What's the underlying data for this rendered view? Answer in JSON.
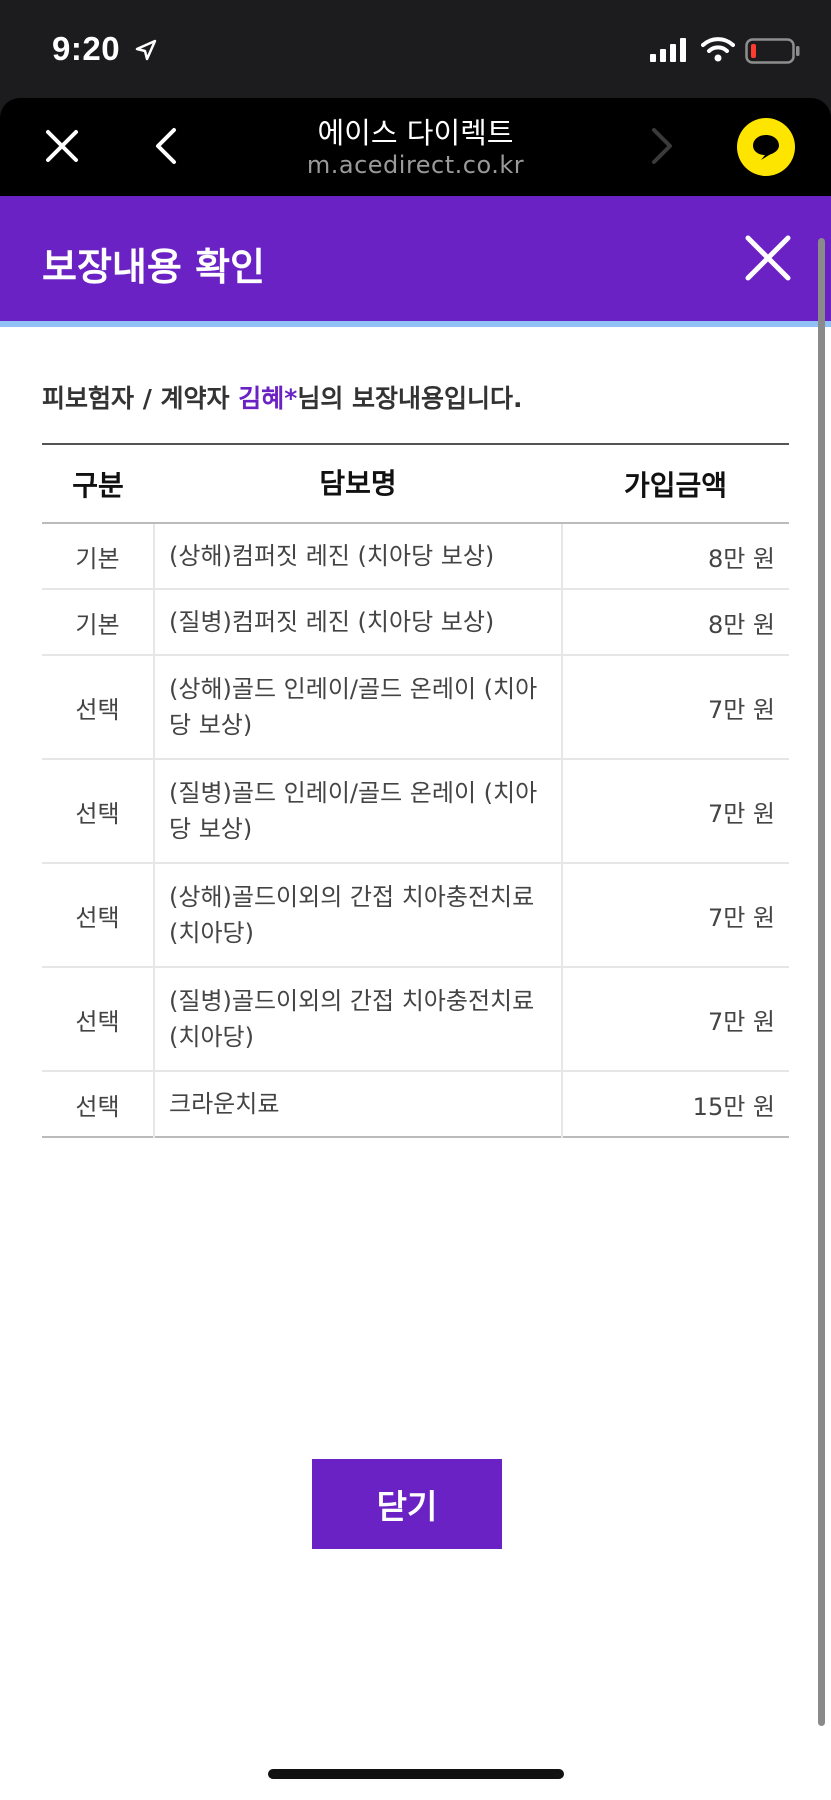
{
  "status_bar": {
    "time": "9:20"
  },
  "browser": {
    "title": "에이스 다이렉트",
    "url": "m.acedirect.co.kr"
  },
  "modal": {
    "title": "보장내용 확인",
    "subtitle_prefix": "피보험자 / 계약자 ",
    "insured_name": "김혜*",
    "subtitle_suffix": "님의 보장내용입니다.",
    "close_button_label": "닫기"
  },
  "table": {
    "headers": [
      "구분",
      "담보명",
      "가입금액"
    ],
    "rows": [
      {
        "type": "기본",
        "name": "(상해)컴퍼짓 레진 (치아당 보상)",
        "amount": "8만 원"
      },
      {
        "type": "기본",
        "name": "(질병)컴퍼짓 레진 (치아당 보상)",
        "amount": "8만 원"
      },
      {
        "type": "선택",
        "name": "(상해)골드 인레이/골드 온레이 (치아당 보상)",
        "amount": "7만 원"
      },
      {
        "type": "선택",
        "name": "(질병)골드 인레이/골드 온레이 (치아당 보상)",
        "amount": "7만 원"
      },
      {
        "type": "선택",
        "name": "(상해)골드이외의 간접 치아충전치료(치아당)",
        "amount": "7만 원"
      },
      {
        "type": "선택",
        "name": "(질병)골드이외의 간접 치아충전치료(치아당)",
        "amount": "7만 원"
      },
      {
        "type": "선택",
        "name": "크라운치료",
        "amount": "15만 원"
      }
    ]
  },
  "colors": {
    "brand_purple": "#6b22c4",
    "header_underline": "#8fc1f5",
    "chat_yellow": "#fde500"
  },
  "icons": {
    "browser_close": "close-icon",
    "browser_back": "chevron-left-icon",
    "browser_forward": "chevron-right-icon",
    "chat": "chat-bubble-icon",
    "modal_close": "close-icon"
  }
}
